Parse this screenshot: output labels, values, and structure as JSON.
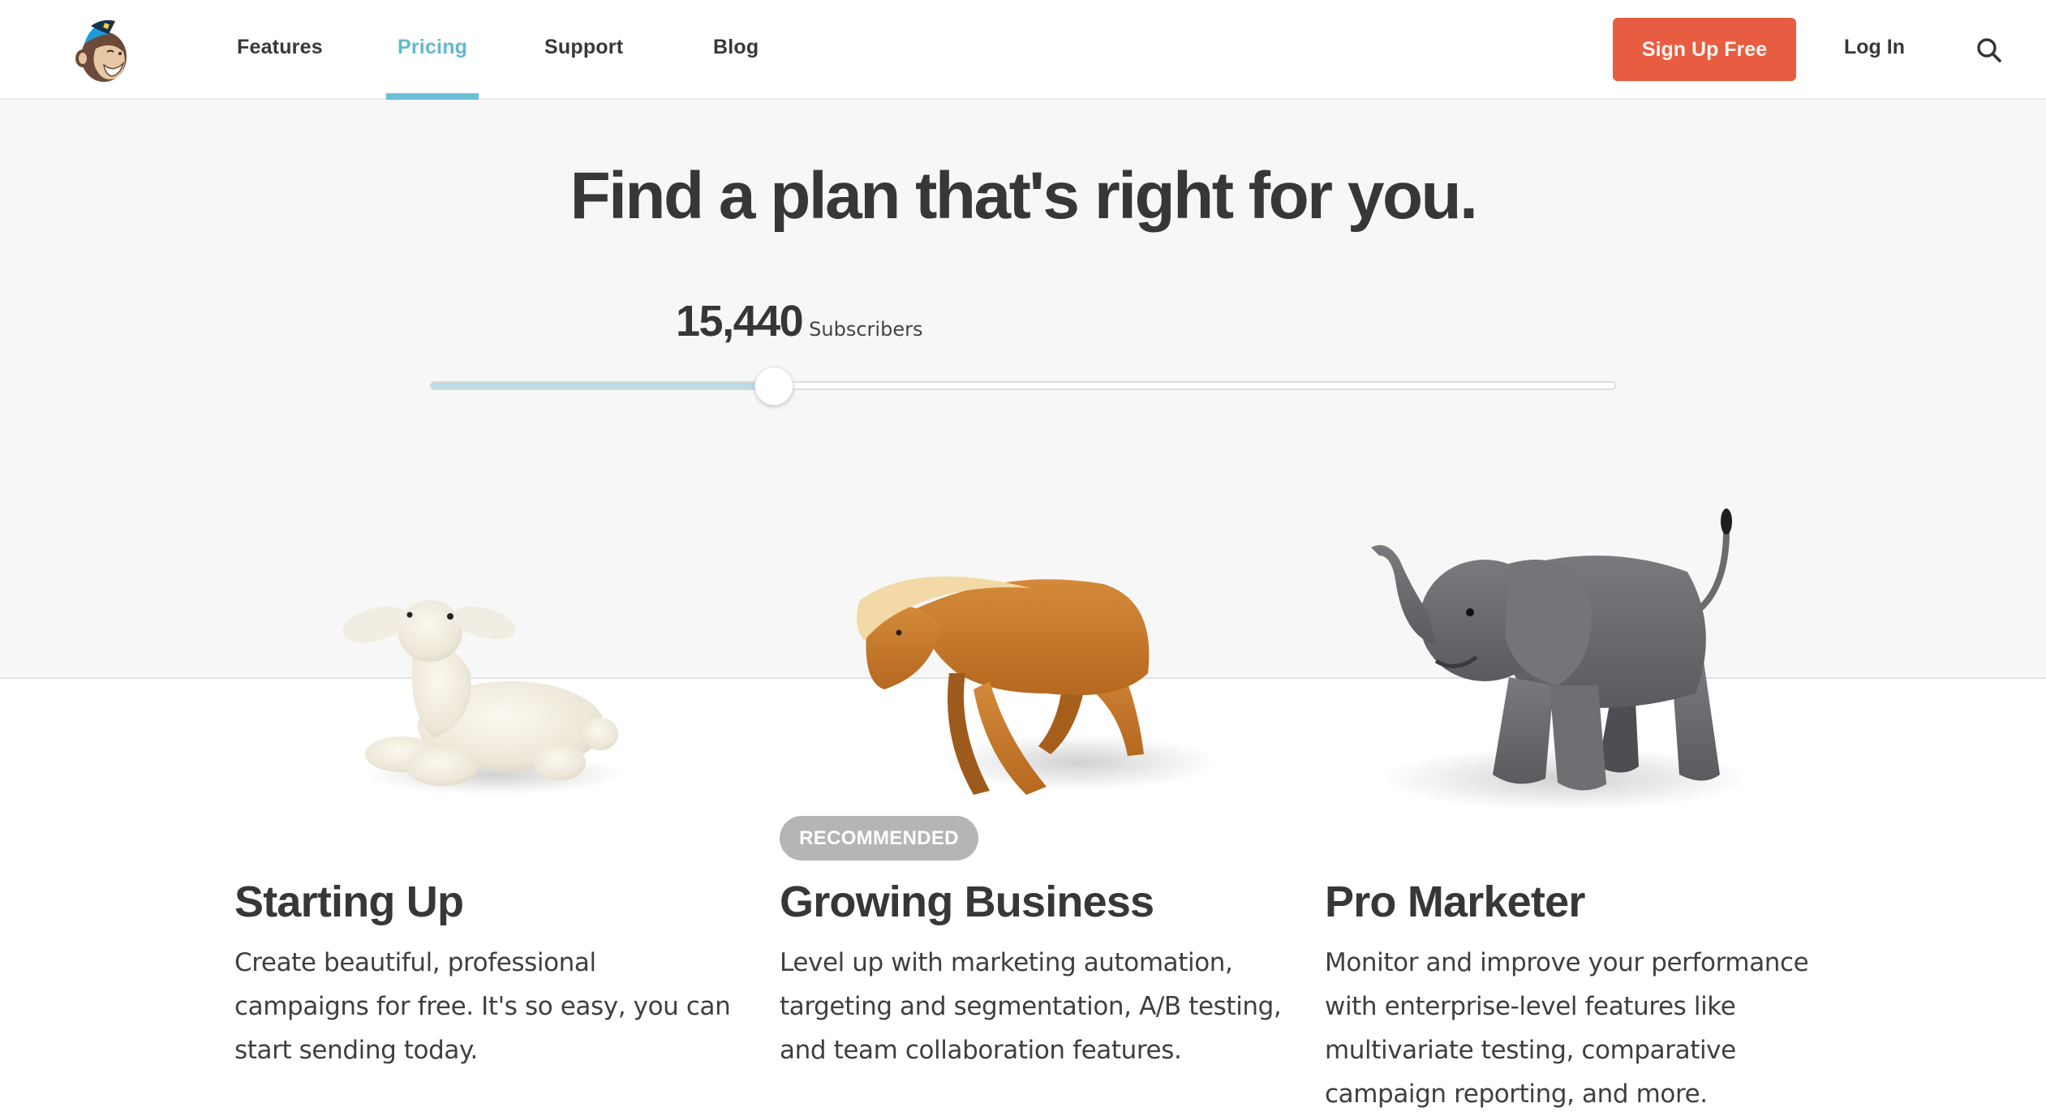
{
  "nav": {
    "logo_icon": "freddie-monkey-logo-icon",
    "items": [
      {
        "label": "Features",
        "active": false
      },
      {
        "label": "Pricing",
        "active": true
      },
      {
        "label": "Support",
        "active": false
      },
      {
        "label": "Blog",
        "active": false
      }
    ],
    "signup_label": "Sign Up Free",
    "login_label": "Log In",
    "search_icon": "search-icon"
  },
  "hero": {
    "headline": "Find a plan that's right for you.",
    "subscriber_count": "15,440",
    "subscriber_label": "Subscribers",
    "slider_fraction": 0.29
  },
  "plans": [
    {
      "name": "Starting Up",
      "image": "lamb-figurine",
      "badge": null,
      "description": "Create beautiful, professional campaigns for free. It's so easy, you can start sending today."
    },
    {
      "name": "Growing Business",
      "image": "pony-figurine",
      "badge": "RECOMMENDED",
      "description": "Level up with marketing automation, targeting and segmentation, A/B testing, and team collaboration features."
    },
    {
      "name": "Pro Marketer",
      "image": "elephant-figurine",
      "badge": null,
      "description": "Monitor and improve your performance with enterprise-level features like multivariate testing, comparative campaign reporting, and more."
    }
  ],
  "colors": {
    "accent": "#63b9cf",
    "signup": "#e85d42",
    "hero_bg": "#f7f7f7",
    "badge_bg": "#b5b5b5",
    "slider_fill": "#b6dde8"
  }
}
